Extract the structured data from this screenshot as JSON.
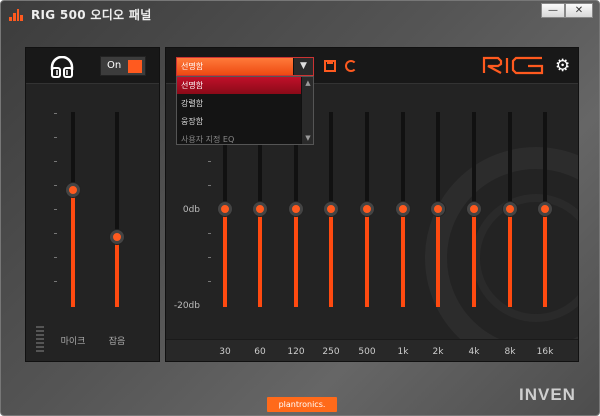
{
  "window": {
    "title": "RIG 500 오디오 패널",
    "minimize_glyph": "—",
    "close_glyph": "✕"
  },
  "colors": {
    "accent": "#ff5a1f",
    "fill": "#ff4a10",
    "panel_bg": "#232323",
    "window_bg": "#555555"
  },
  "left_panel": {
    "headphone_icon": "headphones-icon",
    "power_label": "On",
    "power_on": true,
    "sliders": [
      {
        "label": "마이크",
        "level": 0.6
      },
      {
        "label": "잡음",
        "level": 0.36
      }
    ]
  },
  "eq_panel": {
    "preset_selected": "선명함",
    "preset_options": [
      "선명함",
      "강렬함",
      "웅장함",
      "사용자 지정 EQ"
    ],
    "preset_highlighted": "선명함",
    "save_icon": "save-icon",
    "reset_icon": "reset-icon",
    "brand": "RIG",
    "settings_icon": "gear-icon",
    "db_labels": [
      "0db",
      "-20db"
    ],
    "bands": [
      {
        "freq": "30",
        "value": 0
      },
      {
        "freq": "60",
        "value": 0
      },
      {
        "freq": "120",
        "value": 0
      },
      {
        "freq": "250",
        "value": 0
      },
      {
        "freq": "500",
        "value": 0
      },
      {
        "freq": "1k",
        "value": 0
      },
      {
        "freq": "2k",
        "value": 0
      },
      {
        "freq": "4k",
        "value": 0
      },
      {
        "freq": "8k",
        "value": 0
      },
      {
        "freq": "16k",
        "value": 0
      }
    ]
  },
  "footer": {
    "badge": "plantronics.",
    "watermark": "INVEN"
  }
}
